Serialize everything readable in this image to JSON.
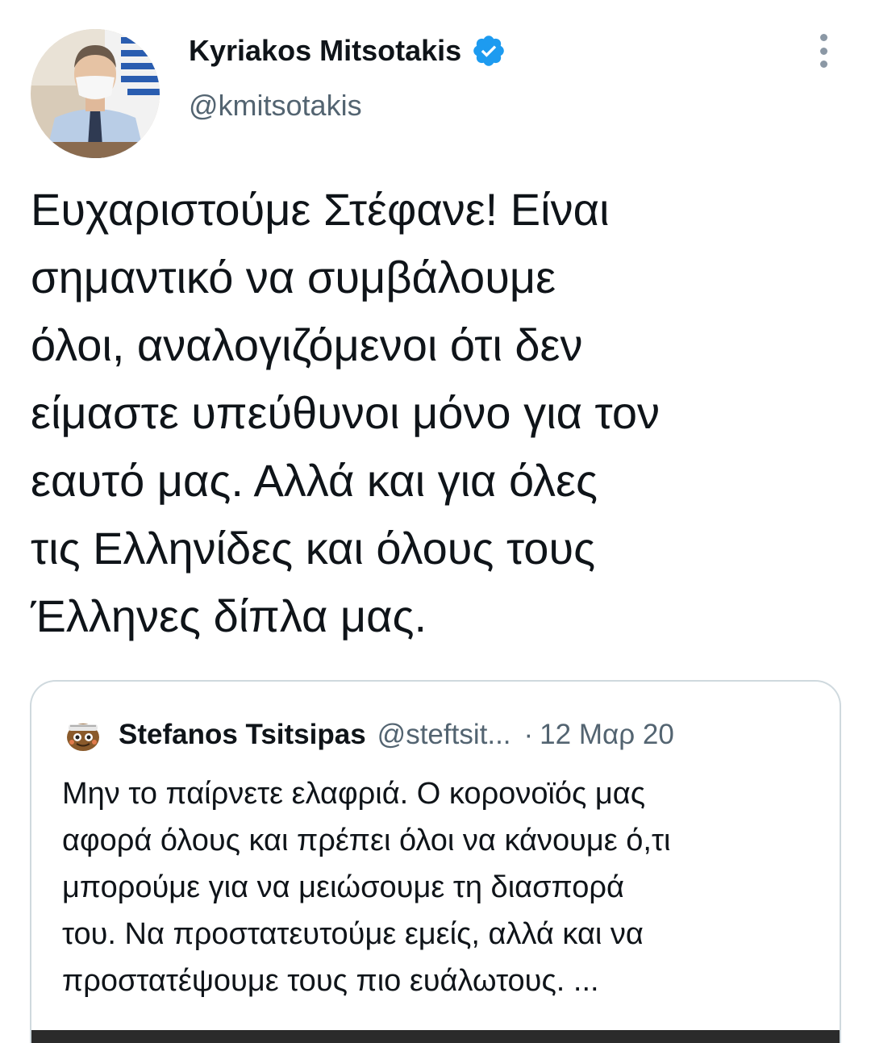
{
  "tweet": {
    "author": {
      "name": "Kyriakos Mitsotakis",
      "handle": "@kmitsotakis",
      "verified_icon": "verified-badge-icon",
      "avatar_icon": "profile-photo-avatar"
    },
    "more_icon": "more-vertical-icon",
    "text_lines": [
      "Ευχαριστούμε Στέφανε! Είναι",
      "σημαντικό να συμβάλουμε",
      "όλοι, αναλογιζόμενοι ότι δεν",
      "είμαστε υπεύθυνοι μόνο για τον",
      "εαυτό μας. Αλλά και για όλες",
      "τις Ελληνίδες και όλους τους",
      "Έλληνες δίπλα μας."
    ]
  },
  "quoted_tweet": {
    "avatar_icon": "emoji-avatar-icon",
    "name": "Stefanos Tsitsipas",
    "handle": "@steftsit...",
    "separator": "·",
    "date": "12 Μαρ 20",
    "text_lines": [
      "Μην το παίρνετε ελαφριά. Ο κορονοϊός μας",
      "αφορά όλους και πρέπει όλοι να κάνουμε ό,τι",
      "μπορούμε για να μειώσουμε τη διασπορά",
      "του. Να προστατευτούμε εμείς, αλλά και να",
      "προστατέψουμε τους πιο ευάλωτους. ..."
    ]
  },
  "colors": {
    "text_primary": "#0f1419",
    "text_secondary": "#536471",
    "verified_blue": "#1d9bf0",
    "border": "#cfd9de",
    "background": "#ffffff"
  }
}
